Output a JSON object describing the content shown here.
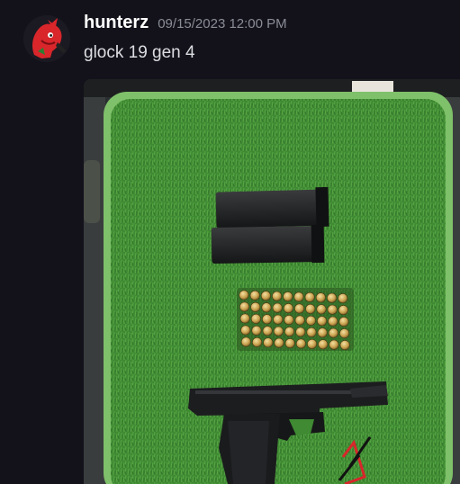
{
  "message": {
    "author": "hunterz",
    "timestamp": "09/15/2023 12:00 PM",
    "content": "glock 19 gen 4"
  },
  "attachment": {
    "type": "image"
  },
  "colors": {
    "background": "#13121b",
    "username": "#ffffff",
    "timestamp": "#8a8d96",
    "content": "#dcdde1",
    "avatar_accent": "#d8262b",
    "grass": "#3f8a33"
  },
  "icons": {
    "avatar": "red-character-avatar-icon"
  }
}
